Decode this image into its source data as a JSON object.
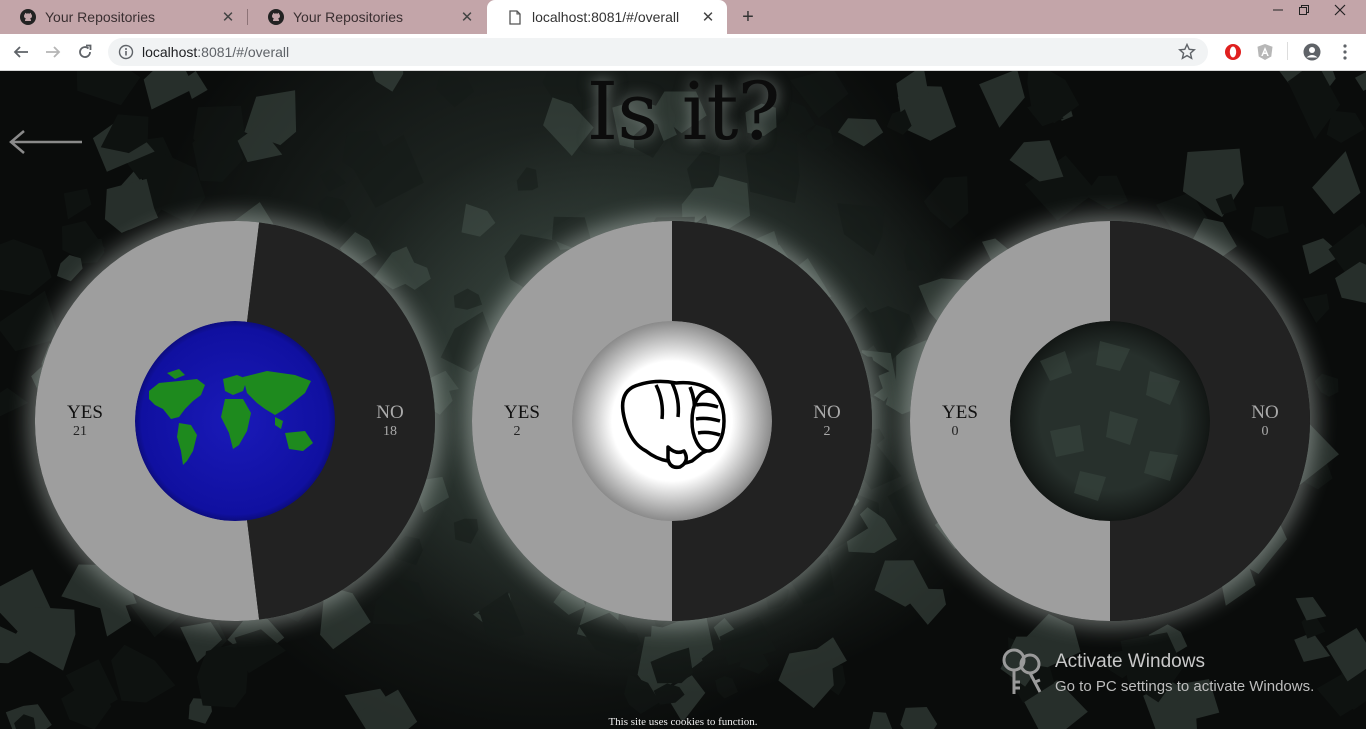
{
  "browser": {
    "tabs": [
      {
        "title": "Your Repositories",
        "icon": "github-icon",
        "active": false
      },
      {
        "title": "Your Repositories",
        "icon": "github-icon",
        "active": false
      },
      {
        "title": "localhost:8081/#/overall",
        "icon": "page-icon",
        "active": true
      }
    ],
    "url_host": "localhost",
    "url_path": ":8081/#/overall"
  },
  "page": {
    "heading": "Is it?",
    "back_icon": "left-arrow-icon",
    "charts": [
      {
        "yes_label": "YES",
        "yes": 21,
        "no_label": "NO",
        "no": 18,
        "center": "world-map"
      },
      {
        "yes_label": "YES",
        "yes": 2,
        "no_label": "NO",
        "no": 2,
        "center": "pointing-hand"
      },
      {
        "yes_label": "YES",
        "yes": 0,
        "no_label": "NO",
        "no": 0,
        "center": "texture"
      }
    ],
    "colors": {
      "yes": "#9e9e9e",
      "no": "#222222"
    },
    "cookie_notice": "This site uses cookies to function."
  },
  "os_overlay": {
    "title": "Activate Windows",
    "subtitle": "Go to PC settings to activate Windows."
  }
}
